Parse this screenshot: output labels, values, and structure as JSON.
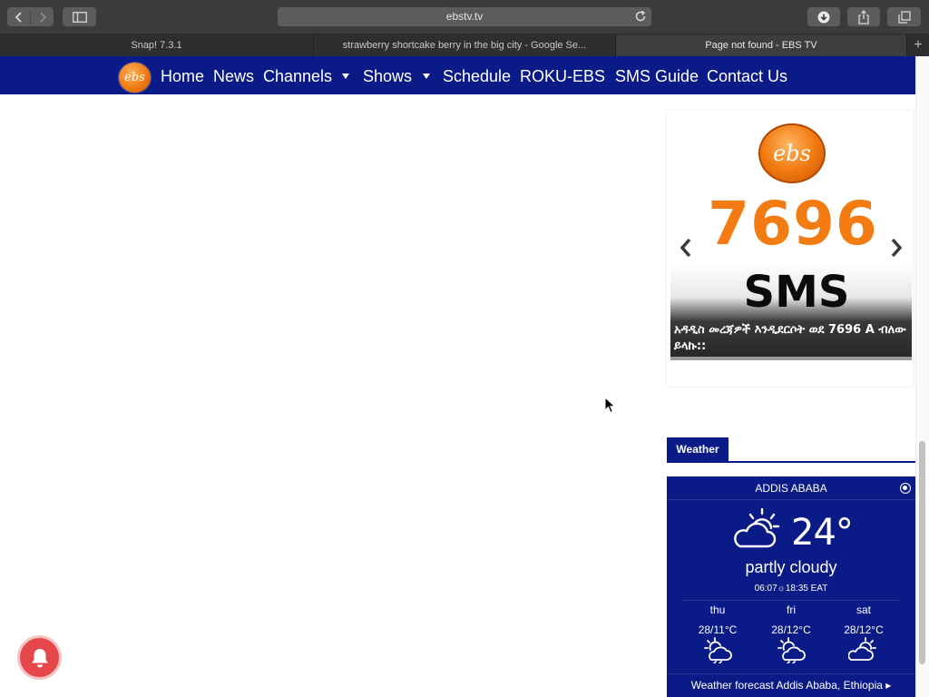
{
  "browser": {
    "url": "ebstv.tv",
    "tabs": [
      {
        "title": "Snap! 7.3.1",
        "active": false
      },
      {
        "title": "strawberry shortcake berry in the big city - Google Se...",
        "active": false
      },
      {
        "title": "Page not found - EBS TV",
        "active": true
      }
    ],
    "new_tab_symbol": "+"
  },
  "site": {
    "logo_text": "ebs",
    "nav": {
      "home": "Home",
      "news": "News",
      "channels": "Channels",
      "shows": "Shows",
      "schedule": "Schedule",
      "roku": "ROKU-EBS",
      "sms_guide": "SMS Guide",
      "contact": "Contact Us"
    },
    "brand_colors": {
      "nav_blue": "#0a1a86",
      "orange": "#f27c12"
    }
  },
  "sms_widget": {
    "logo_text": "ebs",
    "number": "7696",
    "word": "SMS",
    "caption": "አዳዲስ መረጃዎች እንዲደርሶት ወደ 7696 A ብለው ይላኩ::",
    "prev_icon": "chevron-left-icon",
    "next_icon": "chevron-right-icon"
  },
  "weather": {
    "tab_label": "Weather",
    "city": "ADDIS ABABA",
    "temperature": "24°",
    "condition": "partly cloudy",
    "sun_times": "06:07☼18:35 EAT",
    "forecast": [
      {
        "day": "thu",
        "range": "28/11°C",
        "icon": "partly-cloudy-icon"
      },
      {
        "day": "fri",
        "range": "28/12°C",
        "icon": "partly-cloudy-icon"
      },
      {
        "day": "sat",
        "range": "28/12°C",
        "icon": "partly-cloudy-icon"
      }
    ],
    "forecast_link": "Weather forecast Addis Ababa, Ethiopia ▸"
  }
}
